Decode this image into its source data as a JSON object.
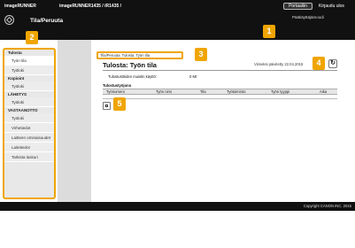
{
  "header": {
    "app_name": "imageRUNNER",
    "device_name": "imageRUNNER1435 / iR1435 /",
    "portal_button": "Portaaliin",
    "logout": "Kirjaudu ulos",
    "admin_mode": "Pääkäyttäjämoodi",
    "page_title": "Tila/Peruuta"
  },
  "sidebar": {
    "sections": [
      {
        "label": "Tulosta",
        "items": [
          "Työn tila",
          "Työloki"
        ]
      },
      {
        "label": "Kopioint",
        "items": [
          "Työloki"
        ]
      },
      {
        "label": "LÄHETYS",
        "items": [
          "Työloki"
        ]
      },
      {
        "label": "VASTAANOTTO",
        "items": [
          "Työloki"
        ]
      },
      {
        "label": "",
        "items": [
          "Virhetiedot",
          "Laitteen ominaisuudet",
          "Laitetiedot",
          "Tarkista laskuri"
        ]
      }
    ]
  },
  "main": {
    "breadcrumb": "Tila/Peruuta: Tulosta: Työn tila",
    "title": "Tulosta: Työn tila",
    "last_updated": "Viimeksi päivitetty 22.04.2015",
    "available_memory_label": "Tulostustöiden muistin käyttö:",
    "available_memory_value": "0 Mt",
    "queue_label": "Tulostustyöjono",
    "table_headers": [
      "Työnumero",
      "Työn nimi",
      "Tila",
      "Työtoiminto",
      "Työn tyyppi",
      "Aika"
    ]
  },
  "badges": [
    "1",
    "2",
    "3",
    "4",
    "5"
  ],
  "footer": {
    "copyright": "Copyright CANON INC. 2015"
  },
  "colors": {
    "accent": "#f0a500",
    "header_bg": "#111111",
    "sidebar_bg": "#e8e8e8"
  }
}
